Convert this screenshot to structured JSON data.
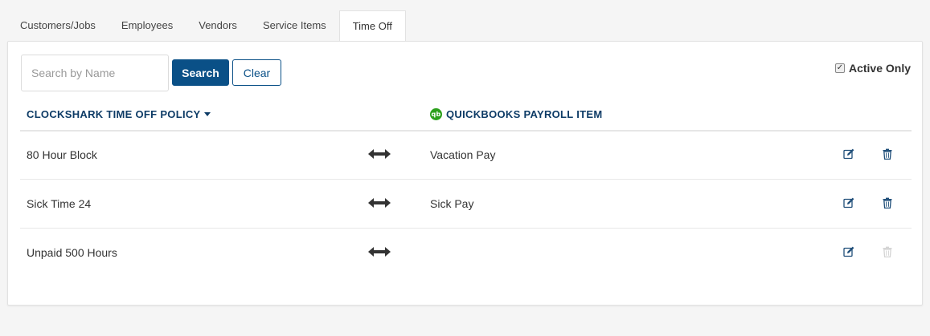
{
  "tabs": [
    {
      "label": "Customers/Jobs",
      "active": false
    },
    {
      "label": "Employees",
      "active": false
    },
    {
      "label": "Vendors",
      "active": false
    },
    {
      "label": "Service Items",
      "active": false
    },
    {
      "label": "Time Off",
      "active": true
    }
  ],
  "search": {
    "placeholder": "Search by Name",
    "value": "",
    "search_label": "Search",
    "clear_label": "Clear"
  },
  "filter": {
    "active_only_label": "Active Only",
    "active_only_checked": true
  },
  "columns": {
    "policy": "CLOCKSHARK TIME OFF POLICY",
    "payroll": "QUICKBOOKS PAYROLL ITEM",
    "qb_logo_text": "qb"
  },
  "rows": [
    {
      "policy": "80 Hour Block",
      "payroll_item": "Vacation Pay",
      "delete_enabled": true
    },
    {
      "policy": "Sick Time 24",
      "payroll_item": "Sick Pay",
      "delete_enabled": true
    },
    {
      "policy": "Unpaid 500 Hours",
      "payroll_item": "",
      "delete_enabled": false
    }
  ],
  "colors": {
    "primary": "#0a5087",
    "header_text": "#0d3b66",
    "quickbooks_green": "#2ca01c",
    "icon": "#1f4e79",
    "icon_disabled": "#cfcfcf"
  },
  "icons": {
    "sort": "caret-down-icon",
    "mapping": "double-arrow-icon",
    "edit": "edit-icon",
    "delete": "trash-icon",
    "quickbooks": "quickbooks-logo-icon"
  }
}
